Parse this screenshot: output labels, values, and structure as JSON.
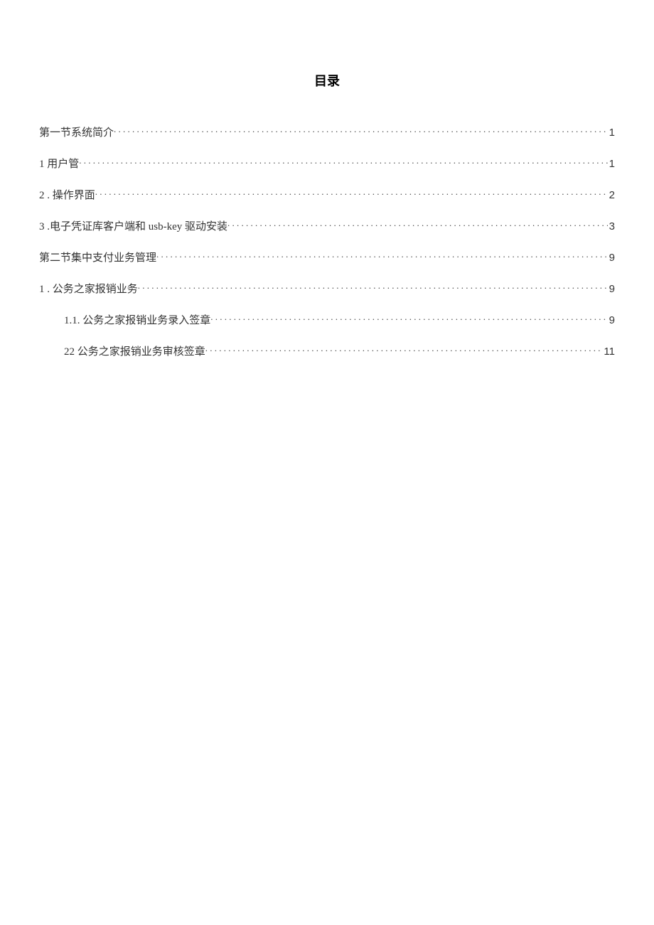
{
  "title": "目录",
  "entries": [
    {
      "label": "第一节系统简介",
      "page": "1",
      "indent": 0
    },
    {
      "label": "1 用户管",
      "page": "1",
      "indent": 0
    },
    {
      "label": "2   . 操作界面",
      "page": "2",
      "indent": 0
    },
    {
      "label": "3   .电子凭证库客户端和 usb-key 驱动安装",
      "page": "3",
      "indent": 0
    },
    {
      "label": "第二节集中支付业务管理",
      "page": "9",
      "indent": 0
    },
    {
      "label": "1   . 公务之家报销业务",
      "page": "9",
      "indent": 0
    },
    {
      "label": "1.1.   公务之家报销业务录入签章",
      "page": "9",
      "indent": 1
    },
    {
      "label": "22 公务之家报销业务审核签章",
      "page": "11",
      "indent": 1
    }
  ]
}
